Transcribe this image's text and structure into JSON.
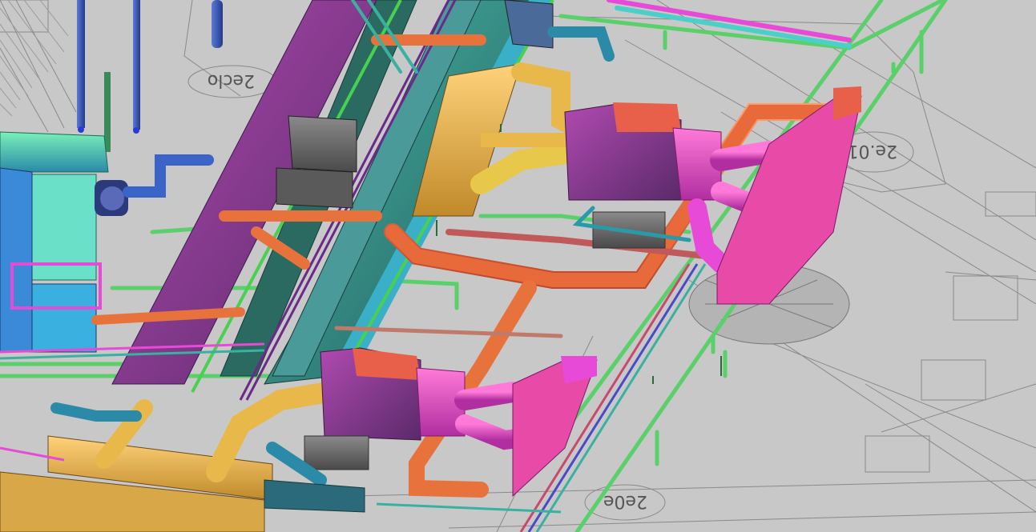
{
  "viewport": {
    "background": "#c8c8c8",
    "linework_color": "#8a8a8a"
  },
  "room_tags": [
    {
      "label": "2eclo"
    },
    {
      "label": "2e.01"
    },
    {
      "label": "2e0e"
    }
  ],
  "systems": {
    "supply_duct": "#e84aa8",
    "return_duct": "#e8723c",
    "exhaust_duct": "#e8b84a",
    "chilled_water": "#4ad06c",
    "condenser_water": "#3a9c8c",
    "hot_water": "#8c3a8c",
    "equipment": "#6a6a6a",
    "ahu": "#3ccca0",
    "domestic_water": "#3a64c8"
  }
}
